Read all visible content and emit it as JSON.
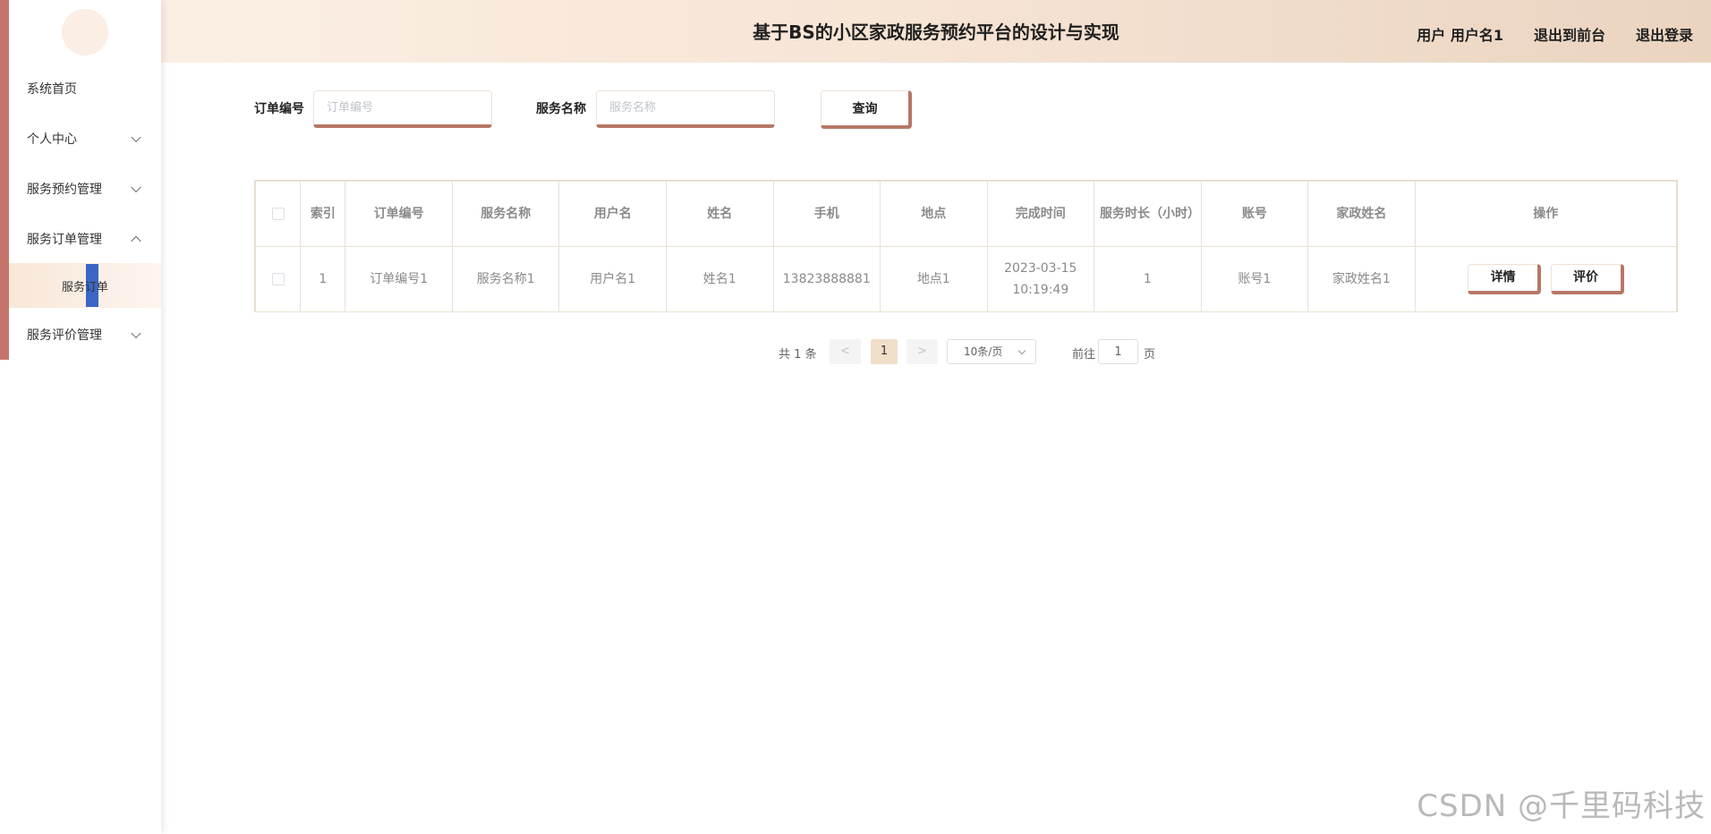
{
  "header": {
    "title": "基于BS的小区家政服务预约平台的设计与实现",
    "user_label": "用户 用户名1",
    "front_link": "退出到前台",
    "logout_link": "退出登录"
  },
  "sidebar": {
    "items": [
      {
        "label": "系统首页",
        "chevron": "none"
      },
      {
        "label": "个人中心",
        "chevron": "down"
      },
      {
        "label": "服务预约管理",
        "chevron": "down"
      },
      {
        "label": "服务订单管理",
        "chevron": "up"
      },
      {
        "label": "服务评价管理",
        "chevron": "down"
      }
    ],
    "active_sub": {
      "label": "服务订单"
    }
  },
  "search": {
    "order_label": "订单编号",
    "order_placeholder": "订单编号",
    "service_label": "服务名称",
    "service_placeholder": "服务名称",
    "query_button": "查询"
  },
  "table": {
    "columns": [
      "",
      "索引",
      "订单编号",
      "服务名称",
      "用户名",
      "姓名",
      "手机",
      "地点",
      "完成时间",
      "服务时长（小时）",
      "账号",
      "家政姓名",
      "操作"
    ],
    "rows": [
      {
        "index": "1",
        "order_no": "订单编号1",
        "service_name": "服务名称1",
        "username": "用户名1",
        "name": "姓名1",
        "phone": "13823888881",
        "location": "地点1",
        "finish_time": "2023-03-15 10:19:49",
        "duration": "1",
        "account": "账号1",
        "housekeeper": "家政姓名1",
        "actions": [
          "详情",
          "评价"
        ]
      }
    ]
  },
  "pagination": {
    "total": "共 1 条",
    "prev": "<",
    "current_page": "1",
    "next": ">",
    "page_size": "10条/页",
    "goto_label": "前往",
    "goto_value": "1",
    "goto_unit": "页"
  },
  "watermark": "CSDN @千里码科技",
  "colors": {
    "accent": "#b77766",
    "sidebar_accent": "#c4746a",
    "header_start": "#fbefe4",
    "header_end": "#ead4c0",
    "active_bg": "#f8e7d8",
    "active_page_bg": "#f0dfc9",
    "submenu_marker": "#3a66c4"
  }
}
